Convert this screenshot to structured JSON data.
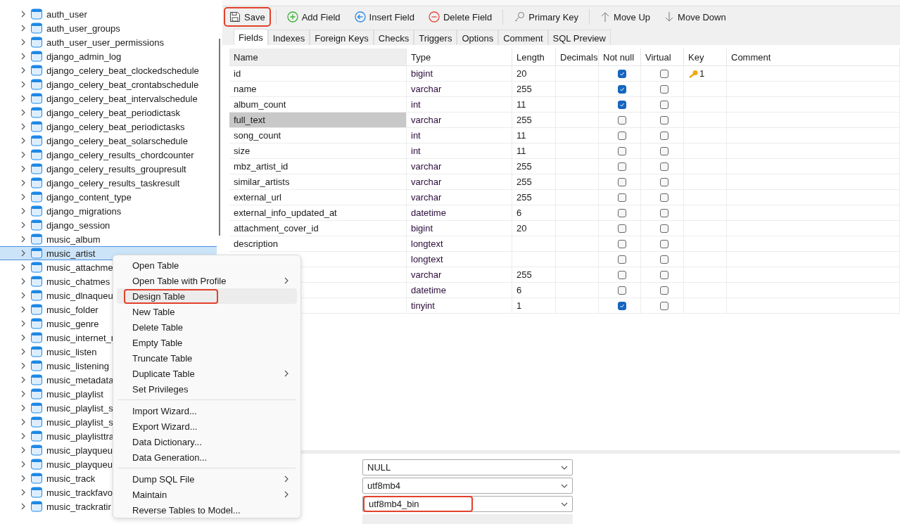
{
  "sidebar": {
    "items": [
      {
        "name": "auth_user",
        "selected": false
      },
      {
        "name": "auth_user_groups",
        "selected": false
      },
      {
        "name": "auth_user_user_permissions",
        "selected": false
      },
      {
        "name": "django_admin_log",
        "selected": false
      },
      {
        "name": "django_celery_beat_clockedschedule",
        "selected": false
      },
      {
        "name": "django_celery_beat_crontabschedule",
        "selected": false
      },
      {
        "name": "django_celery_beat_intervalschedule",
        "selected": false
      },
      {
        "name": "django_celery_beat_periodictask",
        "selected": false
      },
      {
        "name": "django_celery_beat_periodictasks",
        "selected": false
      },
      {
        "name": "django_celery_beat_solarschedule",
        "selected": false
      },
      {
        "name": "django_celery_results_chordcounter",
        "selected": false
      },
      {
        "name": "django_celery_results_groupresult",
        "selected": false
      },
      {
        "name": "django_celery_results_taskresult",
        "selected": false
      },
      {
        "name": "django_content_type",
        "selected": false
      },
      {
        "name": "django_migrations",
        "selected": false
      },
      {
        "name": "django_session",
        "selected": false
      },
      {
        "name": "music_album",
        "selected": false
      },
      {
        "name": "music_artist",
        "selected": true
      },
      {
        "name": "music_attachme",
        "selected": false
      },
      {
        "name": "music_chatmes",
        "selected": false
      },
      {
        "name": "music_dlnaqueu",
        "selected": false
      },
      {
        "name": "music_folder",
        "selected": false
      },
      {
        "name": "music_genre",
        "selected": false
      },
      {
        "name": "music_internet_r",
        "selected": false
      },
      {
        "name": "music_listen",
        "selected": false
      },
      {
        "name": "music_listening",
        "selected": false
      },
      {
        "name": "music_metadata",
        "selected": false
      },
      {
        "name": "music_playlist",
        "selected": false
      },
      {
        "name": "music_playlist_s",
        "selected": false
      },
      {
        "name": "music_playlist_s",
        "selected": false
      },
      {
        "name": "music_playlisttra",
        "selected": false
      },
      {
        "name": "music_playqueu",
        "selected": false
      },
      {
        "name": "music_playqueu",
        "selected": false
      },
      {
        "name": "music_track",
        "selected": false
      },
      {
        "name": "music_trackfavo",
        "selected": false
      },
      {
        "name": "music_trackratir",
        "selected": false
      }
    ]
  },
  "toolbar": {
    "buttons": [
      {
        "kind": "button",
        "label": "Save",
        "highlighted": true
      },
      {
        "kind": "separator"
      },
      {
        "kind": "button",
        "label": "Add Field",
        "highlighted": false
      },
      {
        "kind": "button",
        "label": "Insert Field",
        "highlighted": false
      },
      {
        "kind": "button",
        "label": "Delete Field",
        "highlighted": false
      },
      {
        "kind": "separator"
      },
      {
        "kind": "button",
        "label": "Primary Key",
        "highlighted": false
      },
      {
        "kind": "separator"
      },
      {
        "kind": "button",
        "label": "Move Up",
        "highlighted": false
      },
      {
        "kind": "button",
        "label": "Move Down",
        "highlighted": false
      }
    ]
  },
  "tabs": [
    {
      "label": "Fields",
      "selected": true
    },
    {
      "label": "Indexes",
      "selected": false
    },
    {
      "label": "Foreign Keys",
      "selected": false
    },
    {
      "label": "Checks",
      "selected": false
    },
    {
      "label": "Triggers",
      "selected": false
    },
    {
      "label": "Options",
      "selected": false
    },
    {
      "label": "Comment",
      "selected": false
    },
    {
      "label": "SQL Preview",
      "selected": false
    }
  ],
  "table": {
    "columns": [
      "Name",
      "Type",
      "Length",
      "Decimals",
      "Not null",
      "Virtual",
      "Key",
      "Comment"
    ],
    "rows": [
      {
        "name": "id",
        "type": "bigint",
        "length": "20",
        "not_null": true,
        "virtual": false,
        "key": "1",
        "selected": false
      },
      {
        "name": "name",
        "type": "varchar",
        "length": "255",
        "not_null": true,
        "virtual": false,
        "selected": false
      },
      {
        "name": "album_count",
        "type": "int",
        "length": "11",
        "not_null": true,
        "virtual": false,
        "selected": false
      },
      {
        "name": "full_text",
        "type": "varchar",
        "length": "255",
        "not_null": false,
        "virtual": false,
        "selected": true
      },
      {
        "name": "song_count",
        "type": "int",
        "length": "11",
        "not_null": false,
        "virtual": false,
        "selected": false
      },
      {
        "name": "size",
        "type": "int",
        "length": "11",
        "not_null": false,
        "virtual": false,
        "selected": false
      },
      {
        "name": "mbz_artist_id",
        "type": "varchar",
        "length": "255",
        "not_null": false,
        "virtual": false,
        "selected": false
      },
      {
        "name": "similar_artists",
        "type": "varchar",
        "length": "255",
        "not_null": false,
        "virtual": false,
        "selected": false
      },
      {
        "name": "external_url",
        "type": "varchar",
        "length": "255",
        "not_null": false,
        "virtual": false,
        "selected": false
      },
      {
        "name": "external_info_updated_at",
        "type": "datetime",
        "length": "6",
        "not_null": false,
        "virtual": false,
        "selected": false
      },
      {
        "name": "attachment_cover_id",
        "type": "bigint",
        "length": "20",
        "not_null": false,
        "virtual": false,
        "selected": false
      },
      {
        "name": "description",
        "type": "longtext",
        "not_null": false,
        "virtual": false,
        "selected": false
      },
      {
        "type": "longtext",
        "not_null": false,
        "virtual": false,
        "selected": false
      },
      {
        "type": "varchar",
        "length": "255",
        "not_null": false,
        "virtual": false,
        "selected": false
      },
      {
        "type": "datetime",
        "length": "6",
        "not_null": false,
        "virtual": false,
        "selected": false
      },
      {
        "type": "tinyint",
        "length": "1",
        "not_null": true,
        "virtual": false,
        "selected": false
      }
    ]
  },
  "context_menu": {
    "items": [
      {
        "kind": "item",
        "label": "Open Table",
        "submenu": false,
        "hovered": false,
        "highlighted": false
      },
      {
        "kind": "item",
        "label": "Open Table with Profile",
        "submenu": true,
        "hovered": false,
        "highlighted": false
      },
      {
        "kind": "item",
        "label": "Design Table",
        "submenu": false,
        "hovered": true,
        "highlighted": true
      },
      {
        "kind": "item",
        "label": "New Table",
        "submenu": false,
        "hovered": false,
        "highlighted": false
      },
      {
        "kind": "item",
        "label": "Delete Table",
        "submenu": false,
        "hovered": false,
        "highlighted": false
      },
      {
        "kind": "item",
        "label": "Empty Table",
        "submenu": false,
        "hovered": false,
        "highlighted": false
      },
      {
        "kind": "item",
        "label": "Truncate Table",
        "submenu": false,
        "hovered": false,
        "highlighted": false
      },
      {
        "kind": "item",
        "label": "Duplicate Table",
        "submenu": true,
        "hovered": false,
        "highlighted": false
      },
      {
        "kind": "item",
        "label": "Set Privileges",
        "submenu": false,
        "hovered": false,
        "highlighted": false
      },
      {
        "kind": "separator"
      },
      {
        "kind": "item",
        "label": "Import Wizard...",
        "submenu": false,
        "hovered": false,
        "highlighted": false
      },
      {
        "kind": "item",
        "label": "Export Wizard...",
        "submenu": false,
        "hovered": false,
        "highlighted": false
      },
      {
        "kind": "item",
        "label": "Data Dictionary...",
        "submenu": false,
        "hovered": false,
        "highlighted": false
      },
      {
        "kind": "item",
        "label": "Data Generation...",
        "submenu": false,
        "hovered": false,
        "highlighted": false
      },
      {
        "kind": "separator"
      },
      {
        "kind": "item",
        "label": "Dump SQL File",
        "submenu": true,
        "hovered": false,
        "highlighted": false
      },
      {
        "kind": "item",
        "label": "Maintain",
        "submenu": true,
        "hovered": false,
        "highlighted": false
      },
      {
        "kind": "item",
        "label": "Reverse Tables to Model...",
        "submenu": false,
        "hovered": false,
        "highlighted": false
      }
    ]
  },
  "options": {
    "selects": [
      {
        "value": "NULL",
        "highlighted": false
      },
      {
        "value": "utf8mb4",
        "highlighted": false
      },
      {
        "value": "utf8mb4_bin",
        "highlighted": true
      }
    ]
  }
}
